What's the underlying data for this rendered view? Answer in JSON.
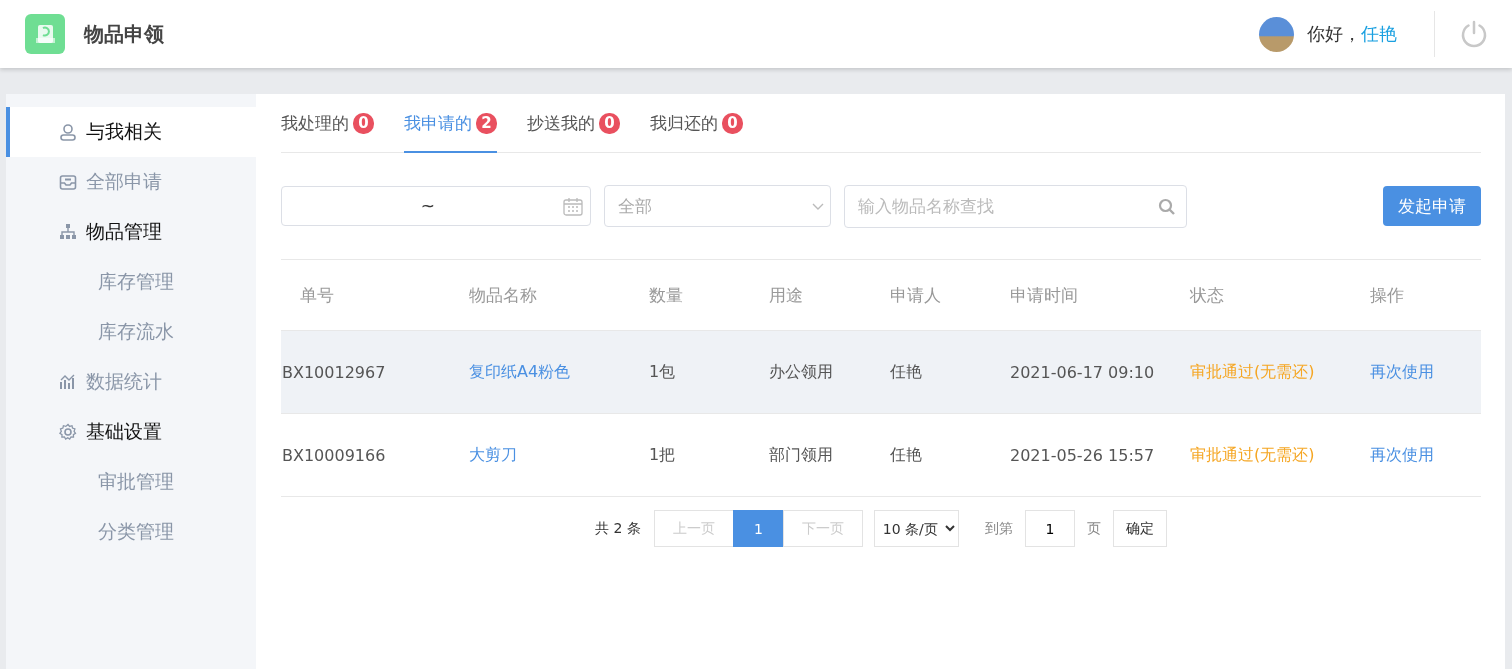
{
  "header": {
    "app_title": "物品申领",
    "greeting": "你好，",
    "user_name": "任艳"
  },
  "sidebar": {
    "items": [
      {
        "label": "与我相关",
        "selected": true,
        "expanded": false
      },
      {
        "label": "全部申请",
        "selected": false,
        "expanded": false
      },
      {
        "label": "物品管理",
        "selected": false,
        "expanded": true,
        "children": [
          {
            "label": "库存管理",
            "selected": false
          },
          {
            "label": "库存流水",
            "selected": false
          }
        ]
      },
      {
        "label": "数据统计",
        "selected": false,
        "expanded": false
      },
      {
        "label": "基础设置",
        "selected": false,
        "expanded": true,
        "children": [
          {
            "label": "审批管理",
            "selected": false
          },
          {
            "label": "分类管理",
            "selected": false
          }
        ]
      }
    ]
  },
  "tabs": [
    {
      "label": "我处理的",
      "count": "0",
      "selected": false
    },
    {
      "label": "我申请的",
      "count": "2",
      "selected": true
    },
    {
      "label": "抄送我的",
      "count": "0",
      "selected": false
    },
    {
      "label": "我归还的",
      "count": "0",
      "selected": false
    }
  ],
  "filters": {
    "date_range": {
      "separator": "~"
    },
    "status_select": {
      "value": "全部"
    },
    "search": {
      "placeholder": "输入物品名称查找"
    },
    "create_button": "发起申请"
  },
  "table": {
    "columns": [
      "单号",
      "物品名称",
      "数量",
      "用途",
      "申请人",
      "申请时间",
      "状态",
      "操作"
    ],
    "rows": [
      {
        "highlighted": true,
        "number": "BX10012967",
        "item": "复印纸A4粉色",
        "quantity": "1包",
        "purpose": "办公领用",
        "applicant": "任艳",
        "time": "2021-06-17 09:10",
        "status": "审批通过(无需还)",
        "action": "再次使用"
      },
      {
        "highlighted": false,
        "number": "BX10009166",
        "item": "大剪刀",
        "quantity": "1把",
        "purpose": "部门领用",
        "applicant": "任艳",
        "time": "2021-05-26 15:57",
        "status": "审批通过(无需还)",
        "action": "再次使用"
      }
    ]
  },
  "pagination": {
    "total": "共 2 条",
    "prev": {
      "label": "上一页",
      "disabled": true
    },
    "pages": [
      {
        "label": "1",
        "selected": true
      }
    ],
    "next": {
      "label": "下一页",
      "disabled": true
    },
    "page_size": "10 条/页",
    "goto_label": "到第",
    "goto_value": "1",
    "page_unit": "页",
    "confirm": "确定"
  }
}
